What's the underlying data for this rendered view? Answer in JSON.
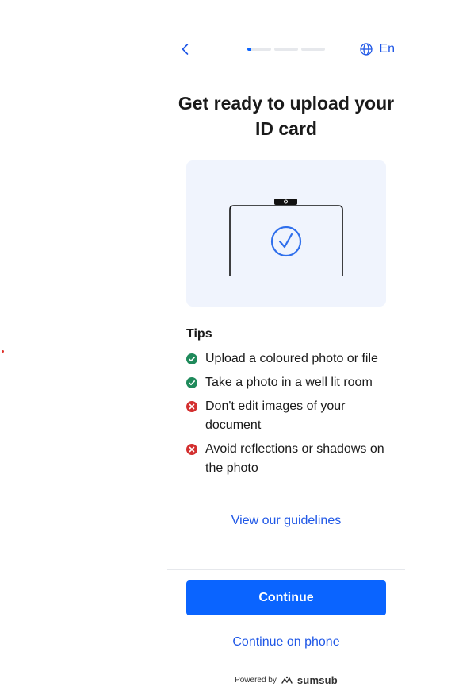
{
  "header": {
    "language": "En",
    "progress_steps": 3
  },
  "main": {
    "title": "Get ready to upload your ID card"
  },
  "tips": {
    "title": "Tips",
    "items": [
      {
        "text": "Upload a coloured photo or file",
        "status": "ok"
      },
      {
        "text": "Take a photo in a well lit room",
        "status": "ok"
      },
      {
        "text": "Don't edit images of your document",
        "status": "bad"
      },
      {
        "text": "Avoid reflections or shadows on the photo",
        "status": "bad"
      }
    ]
  },
  "links": {
    "guidelines": "View our guidelines",
    "continue_phone": "Continue on phone"
  },
  "actions": {
    "continue": "Continue"
  },
  "footer": {
    "powered_by": "Powered by",
    "brand": "sumsub"
  },
  "colors": {
    "accent": "#0a64ff",
    "link": "#1f57e6",
    "ok": "#1f8a5b",
    "bad": "#d32f2f",
    "illustration_bg": "#f0f4fd"
  },
  "icons": {
    "back": "chevron-left-icon",
    "language": "globe-icon",
    "illustration_check": "check-circle-icon",
    "tip_ok": "check-circle-filled-icon",
    "tip_bad": "x-circle-filled-icon",
    "brand_logo": "sumsub-logo-icon"
  }
}
